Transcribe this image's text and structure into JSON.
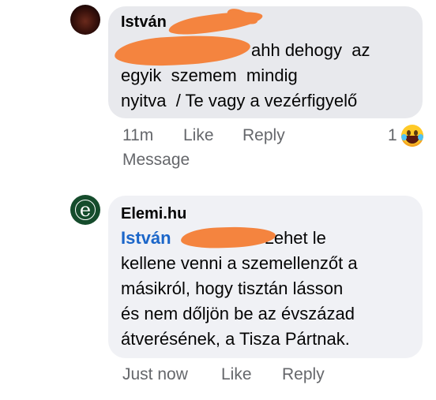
{
  "comments": [
    {
      "author": "István",
      "text_lines": [
        "ahh dehogy  az",
        "egyik  szemem  mindig",
        "nyitva  / Te vagy a vezérfigyelő"
      ],
      "time": "11m",
      "like_label": "Like",
      "reply_label": "Reply",
      "message_label": "Message",
      "reaction_count": "1",
      "reaction_icon": "laughing-tears-emoji"
    },
    {
      "author": "Elemi.hu",
      "mention": "István",
      "text_lines": [
        "Lehet le",
        "kellene venni a szemellenzőt a",
        "másikról, hogy tisztán lásson",
        "és nem dőljön be az évszázad",
        "átverésének, a Tisza Pártnak."
      ],
      "time": "Just now",
      "like_label": "Like",
      "reply_label": "Reply",
      "avatar_letter": "e"
    }
  ]
}
